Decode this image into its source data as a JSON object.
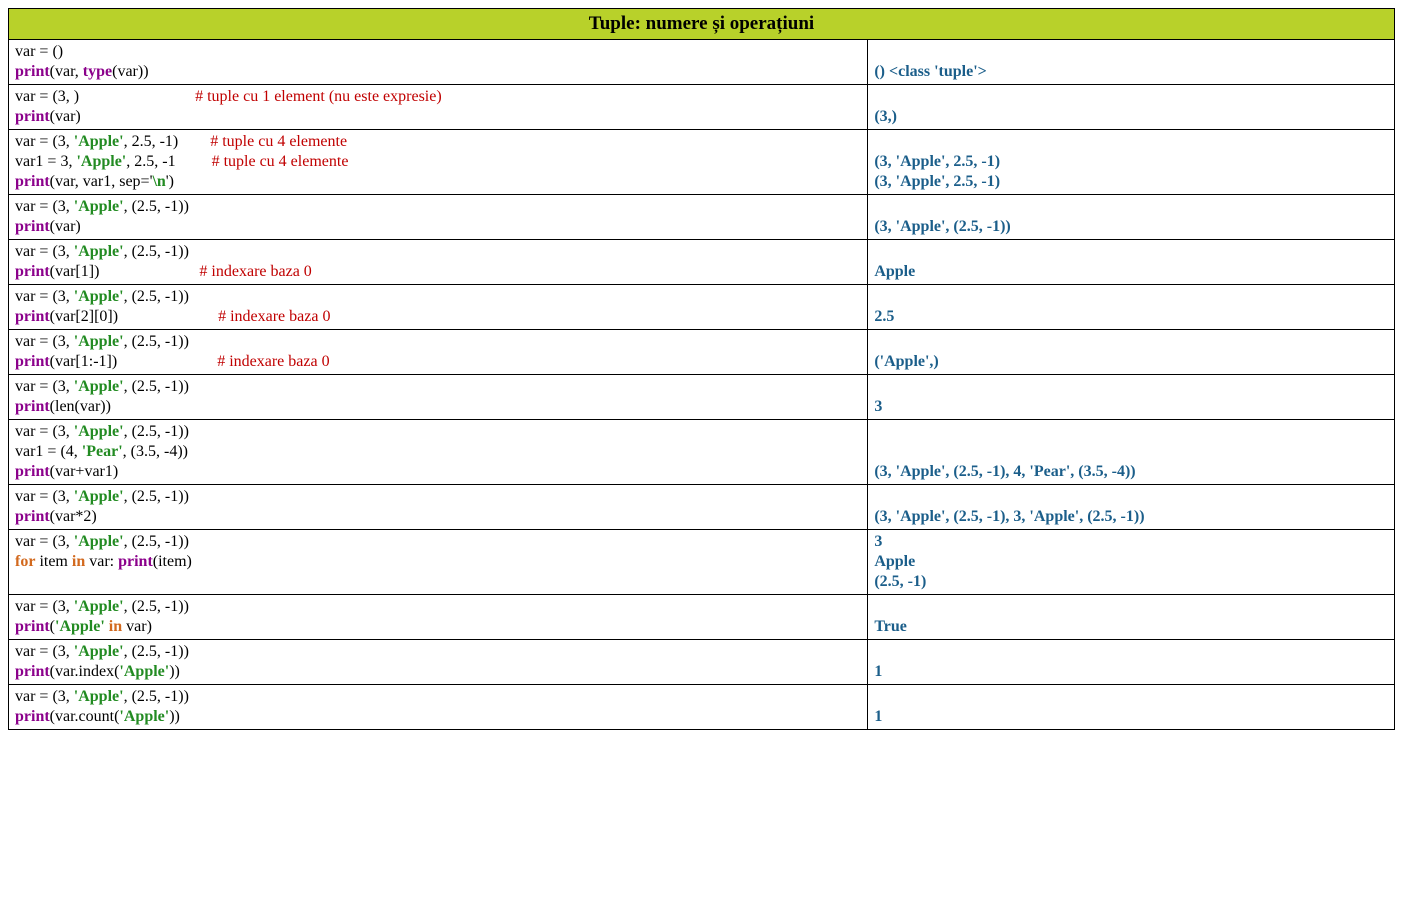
{
  "title": "Tuple: numere și operațiuni",
  "colors": {
    "keyword": "#8b008b",
    "string": "#228b22",
    "comment": "#c00000",
    "loopkw": "#d2691e",
    "output": "#1b5e8a",
    "headerbg": "#b8d12a"
  },
  "rows": [
    {
      "code": [
        [
          {
            "t": "var = ()"
          }
        ],
        [
          {
            "t": "print",
            "c": "kw-purple"
          },
          {
            "t": "(var, "
          },
          {
            "t": "type",
            "c": "kw-purple"
          },
          {
            "t": "(var))"
          }
        ]
      ],
      "out": "() <class 'tuple'>"
    },
    {
      "code": [
        [
          {
            "t": "var = (3, )                             "
          },
          {
            "t": "# tuple cu 1 element (nu este expresie)",
            "c": "comment-red"
          }
        ],
        [
          {
            "t": "print",
            "c": "kw-purple"
          },
          {
            "t": "(var)"
          }
        ]
      ],
      "out": "(3,)"
    },
    {
      "code": [
        [
          {
            "t": "var = (3, "
          },
          {
            "t": "'Apple'",
            "c": "str-green"
          },
          {
            "t": ", 2.5, -1)        "
          },
          {
            "t": "# tuple cu 4 elemente",
            "c": "comment-red"
          }
        ],
        [
          {
            "t": "var1 = 3, "
          },
          {
            "t": "'Apple'",
            "c": "str-green"
          },
          {
            "t": ", 2.5, -1         "
          },
          {
            "t": "# tuple cu 4 elemente",
            "c": "comment-red"
          }
        ],
        [
          {
            "t": "print",
            "c": "kw-purple"
          },
          {
            "t": "(var, var1, sep='"
          },
          {
            "t": "\\n",
            "c": "str-green"
          },
          {
            "t": "')"
          }
        ]
      ],
      "out": "(3, 'Apple', 2.5, -1)\n(3, 'Apple', 2.5, -1)"
    },
    {
      "code": [
        [
          {
            "t": "var = (3, "
          },
          {
            "t": "'Apple'",
            "c": "str-green"
          },
          {
            "t": ", (2.5, -1))"
          }
        ],
        [
          {
            "t": "print",
            "c": "kw-purple"
          },
          {
            "t": "(var)"
          }
        ]
      ],
      "out": "(3, 'Apple', (2.5, -1))"
    },
    {
      "code": [
        [
          {
            "t": "var = (3, "
          },
          {
            "t": "'Apple'",
            "c": "str-green"
          },
          {
            "t": ", (2.5, -1))"
          }
        ],
        [
          {
            "t": "print",
            "c": "kw-purple"
          },
          {
            "t": "(var[1])                         "
          },
          {
            "t": "# indexare baza 0",
            "c": "comment-red"
          }
        ]
      ],
      "out": "Apple"
    },
    {
      "code": [
        [
          {
            "t": "var = (3, "
          },
          {
            "t": "'Apple'",
            "c": "str-green"
          },
          {
            "t": ", (2.5, -1))"
          }
        ],
        [
          {
            "t": "print",
            "c": "kw-purple"
          },
          {
            "t": "(var[2][0])                         "
          },
          {
            "t": "# indexare baza 0",
            "c": "comment-red"
          }
        ]
      ],
      "out": "2.5"
    },
    {
      "code": [
        [
          {
            "t": "var = (3, "
          },
          {
            "t": "'Apple'",
            "c": "str-green"
          },
          {
            "t": ", (2.5, -1))"
          }
        ],
        [
          {
            "t": "print",
            "c": "kw-purple"
          },
          {
            "t": "(var[1:-1])                         "
          },
          {
            "t": "# indexare baza 0",
            "c": "comment-red"
          }
        ]
      ],
      "out": "('Apple',)"
    },
    {
      "code": [
        [
          {
            "t": "var = (3, "
          },
          {
            "t": "'Apple'",
            "c": "str-green"
          },
          {
            "t": ", (2.5, -1))"
          }
        ],
        [
          {
            "t": "print",
            "c": "kw-purple"
          },
          {
            "t": "(len(var))"
          }
        ]
      ],
      "out": "3"
    },
    {
      "code": [
        [
          {
            "t": "var = (3, "
          },
          {
            "t": "'Apple'",
            "c": "str-green"
          },
          {
            "t": ", (2.5, -1))"
          }
        ],
        [
          {
            "t": "var1 = (4, "
          },
          {
            "t": "'Pear'",
            "c": "str-green"
          },
          {
            "t": ", (3.5, -4))"
          }
        ],
        [
          {
            "t": "print",
            "c": "kw-purple"
          },
          {
            "t": "(var+var1)"
          }
        ]
      ],
      "out": "(3, 'Apple', (2.5, -1), 4, 'Pear', (3.5, -4))"
    },
    {
      "code": [
        [
          {
            "t": "var = (3, "
          },
          {
            "t": "'Apple'",
            "c": "str-green"
          },
          {
            "t": ", (2.5, -1))"
          }
        ],
        [
          {
            "t": "print",
            "c": "kw-purple"
          },
          {
            "t": "(var*2)"
          }
        ]
      ],
      "out": "(3, 'Apple', (2.5, -1), 3, 'Apple', (2.5, -1))"
    },
    {
      "code": [
        [
          {
            "t": "var = (3, "
          },
          {
            "t": "'Apple'",
            "c": "str-green"
          },
          {
            "t": ", (2.5, -1))"
          }
        ],
        [
          {
            "t": "for",
            "c": "kw-orange"
          },
          {
            "t": " item "
          },
          {
            "t": "in",
            "c": "kw-orange"
          },
          {
            "t": " var: "
          },
          {
            "t": "print",
            "c": "kw-purple"
          },
          {
            "t": "(item)"
          }
        ]
      ],
      "out": "3\nApple\n(2.5, -1)",
      "outAlign": "top"
    },
    {
      "code": [
        [
          {
            "t": "var = (3, "
          },
          {
            "t": "'Apple'",
            "c": "str-green"
          },
          {
            "t": ", (2.5, -1))"
          }
        ],
        [
          {
            "t": "print",
            "c": "kw-purple"
          },
          {
            "t": "("
          },
          {
            "t": "'Apple'",
            "c": "str-green"
          },
          {
            "t": " "
          },
          {
            "t": "in",
            "c": "kw-orange"
          },
          {
            "t": " var)"
          }
        ]
      ],
      "out": "True"
    },
    {
      "code": [
        [
          {
            "t": "var = (3, "
          },
          {
            "t": "'Apple'",
            "c": "str-green"
          },
          {
            "t": ", (2.5, -1))"
          }
        ],
        [
          {
            "t": "print",
            "c": "kw-purple"
          },
          {
            "t": "(var.index("
          },
          {
            "t": "'Apple'",
            "c": "str-green"
          },
          {
            "t": "))"
          }
        ]
      ],
      "out": "1"
    },
    {
      "code": [
        [
          {
            "t": "var = (3, "
          },
          {
            "t": "'Apple'",
            "c": "str-green"
          },
          {
            "t": ", (2.5, -1))"
          }
        ],
        [
          {
            "t": "print",
            "c": "kw-purple"
          },
          {
            "t": "(var.count("
          },
          {
            "t": "'Apple'",
            "c": "str-green"
          },
          {
            "t": "))"
          }
        ]
      ],
      "out": "1"
    }
  ]
}
